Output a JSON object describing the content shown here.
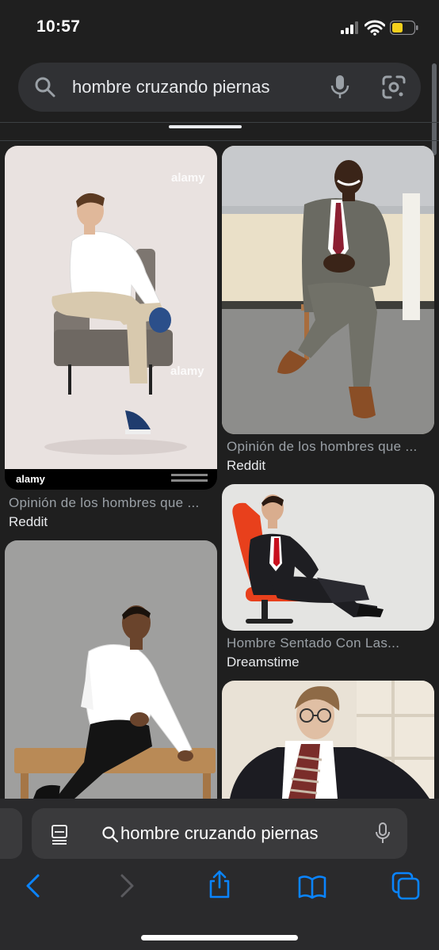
{
  "status_bar": {
    "time": "10:57",
    "battery_color": "#f4d01c"
  },
  "search": {
    "query": "hombre cruzando piernas"
  },
  "results": [
    {
      "title": "Opinión de los hombres que ...",
      "source": "Reddit",
      "watermark": "alamy",
      "image_desc": "man in white shirt crossing legs on grey armchair"
    },
    {
      "title": "Opinión de los hombres que ...",
      "source": "Reddit",
      "image_desc": "man in grey suit sitting with crossed legs"
    },
    {
      "title": "Hombre Sentado Con Las...",
      "source": "Dreamstime",
      "image_desc": "businessman on red office chair"
    },
    {
      "title": "",
      "source": "",
      "image_desc": "man in white shirt sitting on wooden bench"
    },
    {
      "title": "",
      "source": "",
      "image_desc": "man with glasses in pinstripe suit"
    }
  ],
  "safari": {
    "address_text": "hombre cruzando piernas",
    "toolbar": [
      "back-icon",
      "forward-icon",
      "share-icon",
      "bookmarks-icon",
      "tabs-icon"
    ],
    "accent": "#0a84ff"
  }
}
